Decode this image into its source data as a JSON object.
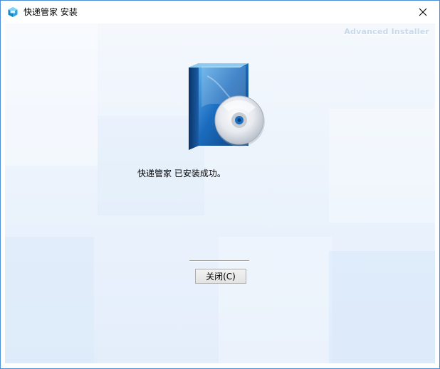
{
  "window": {
    "title": "快递管家 安装"
  },
  "banner": {
    "brand": "Advanced Installer"
  },
  "main": {
    "message": "快递管家 已安装成功。",
    "close_button": "关闭(C)"
  },
  "icons": {
    "app": "package-icon",
    "product": "software-box-cd-icon",
    "close": "close-icon"
  },
  "colors": {
    "window_border": "#4a90d9",
    "background": "#eaf2fc",
    "box_blue": "#1b5ea8"
  }
}
